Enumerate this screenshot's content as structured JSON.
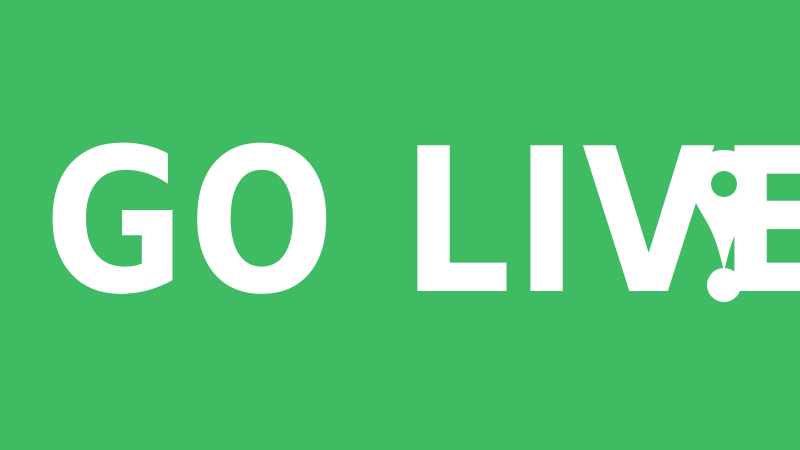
{
  "banner": {
    "headline": "GO LIVE",
    "background_color": "#3fbb63",
    "text_color": "#ffffff",
    "icon": "map-pin-exclamation-icon"
  }
}
